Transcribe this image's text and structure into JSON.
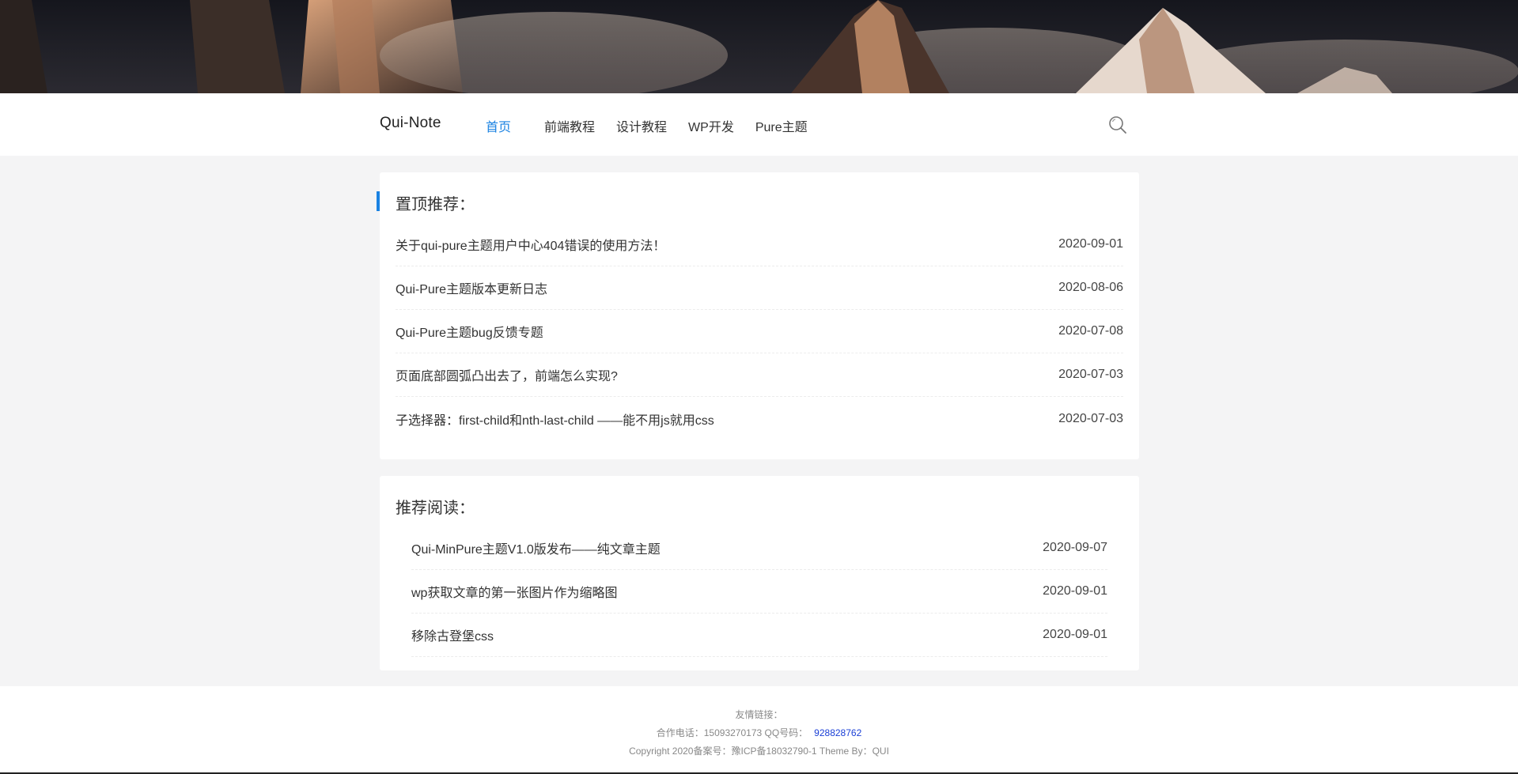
{
  "header": {
    "brand": "Qui-Note",
    "nav": [
      "首页",
      "前端教程",
      "设计教程",
      "WP开发",
      "Pure主题"
    ],
    "active_nav": "首页"
  },
  "sticky": {
    "title": "置顶推荐：",
    "posts": [
      {
        "title": "关于qui-pure主题用户中心404错误的使用方法！",
        "date": "2020-09-01"
      },
      {
        "title": "Qui-Pure主题版本更新日志",
        "date": "2020-08-06"
      },
      {
        "title": "Qui-Pure主题bug反馈专题",
        "date": "2020-07-08"
      },
      {
        "title": "页面底部圆弧凸出去了，前端怎么实现?",
        "date": "2020-07-03"
      },
      {
        "title": "子选择器：first-child和nth-last-child ——能不用js就用css",
        "date": "2020-07-03"
      }
    ]
  },
  "recommended": {
    "title": "推荐阅读：",
    "posts": [
      {
        "title": "Qui-MinPure主题V1.0版发布——纯文章主题",
        "date": "2020-09-07"
      },
      {
        "title": "wp获取文章的第一张图片作为缩略图",
        "date": "2020-09-01"
      },
      {
        "title": "移除古登堡css",
        "date": "2020-09-01"
      }
    ]
  },
  "footer": {
    "links_label": "友情链接：",
    "contact": "合作电话：15093270173 QQ号码：",
    "qq": "928828762",
    "copyright": "Copyright 2020备案号：豫ICP备18032790-1 Theme By：QUI"
  },
  "colors": {
    "accent": "#1a82e2",
    "background": "#f4f4f5",
    "panel": "#ffffff"
  },
  "icons": {
    "search": "search-icon"
  }
}
